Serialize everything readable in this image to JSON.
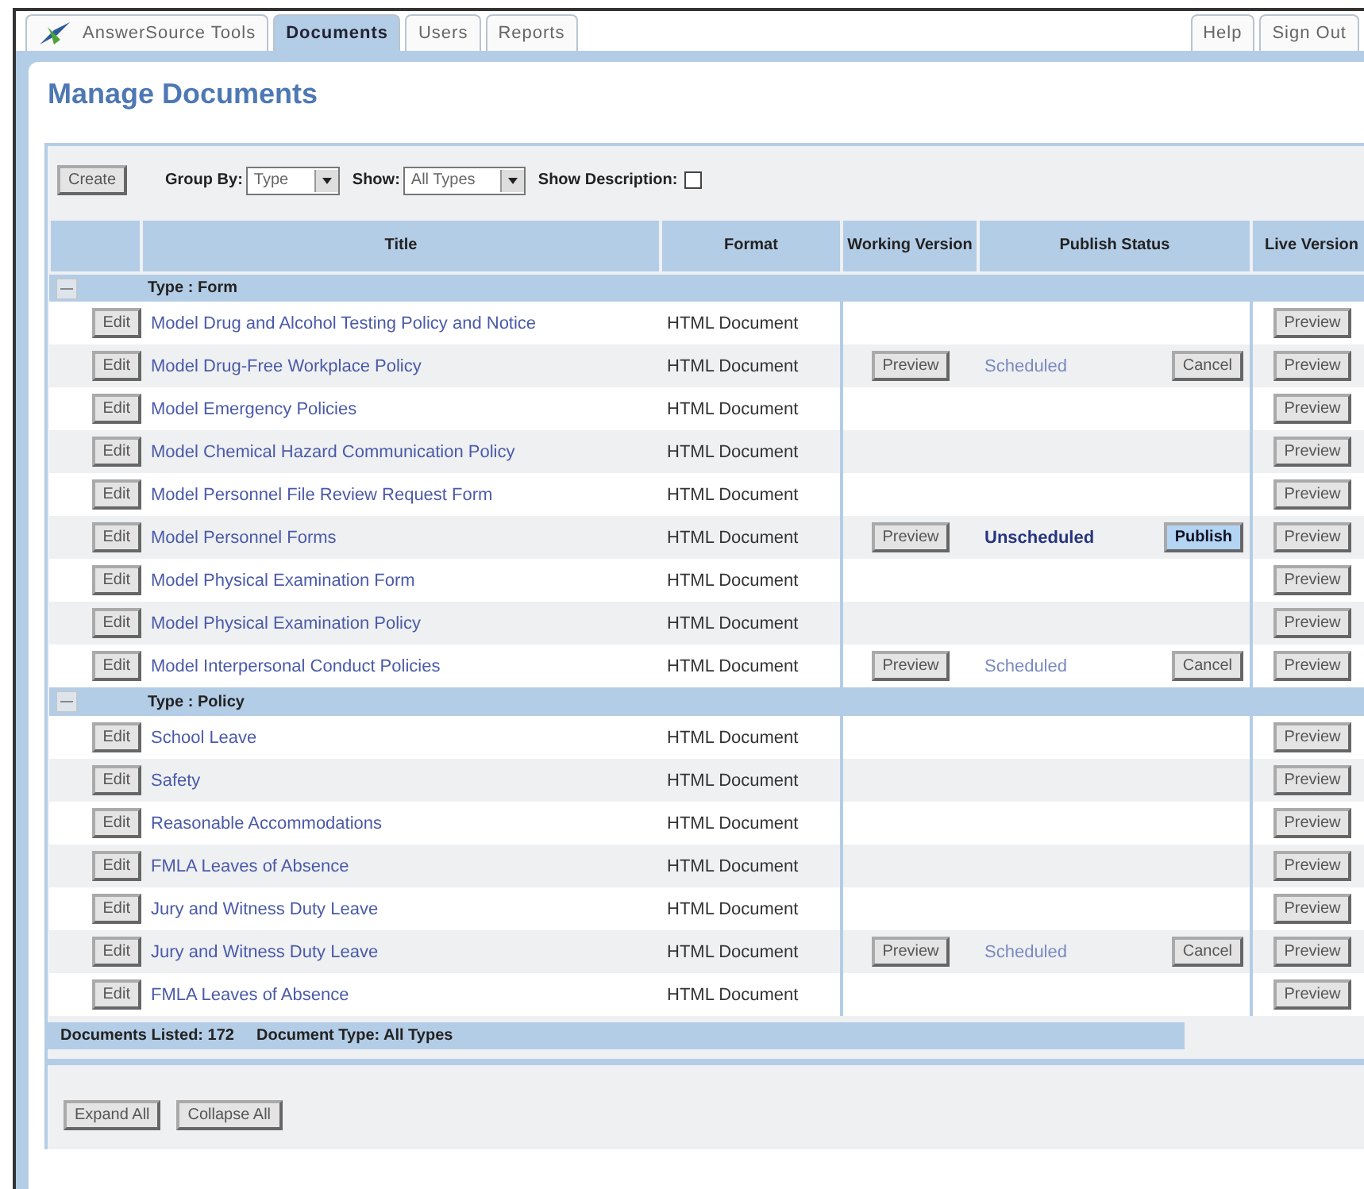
{
  "tabs": [
    {
      "label": "AnswerSource Tools",
      "selected": false,
      "kind": "brand"
    },
    {
      "label": "Documents",
      "selected": true,
      "kind": "main"
    },
    {
      "label": "Users",
      "selected": false,
      "kind": "main"
    },
    {
      "label": "Reports",
      "selected": false,
      "kind": "main"
    },
    {
      "label": "Help",
      "selected": false,
      "kind": "right"
    },
    {
      "label": "Sign Out",
      "selected": false,
      "kind": "right"
    }
  ],
  "heading": "Manage Documents",
  "toolbar": {
    "create": "Create",
    "group_by": {
      "label": "Group By:",
      "value": "Type"
    },
    "show": {
      "label": "Show:",
      "value": "All Types"
    },
    "show_description": {
      "label": "Show Description:",
      "checked": false
    }
  },
  "table": {
    "columns": [
      "Title",
      "Format",
      "Working Version",
      "Publish Status",
      "Live Version"
    ],
    "groups": [
      {
        "label": "Type : Form",
        "expanded": true,
        "rows": [
          {
            "edit": "Edit",
            "title": "Model Drug and Alcohol Testing Policy and Notice",
            "format": "HTML Document",
            "live": "Preview"
          },
          {
            "edit": "Edit",
            "title": "Model Drug-Free Workplace Policy",
            "format": "HTML Document",
            "working": "Preview",
            "status": "Scheduled",
            "scheduled": true,
            "action": "Cancel",
            "live": "Preview"
          },
          {
            "edit": "Edit",
            "title": "Model Emergency Policies",
            "format": "HTML Document",
            "live": "Preview"
          },
          {
            "edit": "Edit",
            "title": "Model Chemical Hazard Communication Policy",
            "format": "HTML Document",
            "live": "Preview"
          },
          {
            "edit": "Edit",
            "title": "Model Personnel File Review Request Form",
            "format": "HTML Document",
            "live": "Preview"
          },
          {
            "edit": "Edit",
            "title": "Model Personnel Forms",
            "format": "HTML Document",
            "working": "Preview",
            "status": "Unscheduled",
            "scheduled": false,
            "action": "Publish",
            "live": "Preview"
          },
          {
            "edit": "Edit",
            "title": "Model Physical Examination Form",
            "format": "HTML Document",
            "live": "Preview"
          },
          {
            "edit": "Edit",
            "title": "Model Physical Examination Policy",
            "format": "HTML Document",
            "live": "Preview"
          },
          {
            "edit": "Edit",
            "title": "Model Interpersonal Conduct Policies",
            "format": "HTML Document",
            "working": "Preview",
            "status": "Scheduled",
            "scheduled": true,
            "action": "Cancel",
            "live": "Preview"
          }
        ]
      },
      {
        "label": "Type : Policy",
        "expanded": true,
        "rows": [
          {
            "edit": "Edit",
            "title": "School Leave",
            "format": "HTML Document",
            "live": "Preview"
          },
          {
            "edit": "Edit",
            "title": "Safety",
            "format": "HTML Document",
            "live": "Preview"
          },
          {
            "edit": "Edit",
            "title": "Reasonable Accommodations",
            "format": "HTML Document",
            "live": "Preview"
          },
          {
            "edit": "Edit",
            "title": "FMLA Leaves of Absence",
            "format": "HTML Document",
            "live": "Preview"
          },
          {
            "edit": "Edit",
            "title": "Jury and Witness Duty Leave",
            "format": "HTML Document",
            "live": "Preview"
          },
          {
            "edit": "Edit",
            "title": "Jury and Witness Duty Leave",
            "format": "HTML Document",
            "working": "Preview",
            "status": "Scheduled",
            "scheduled": true,
            "action": "Cancel",
            "live": "Preview"
          },
          {
            "edit": "Edit",
            "title": "FMLA Leaves of Absence",
            "format": "HTML Document",
            "live": "Preview"
          }
        ]
      }
    ]
  },
  "status_bar": [
    "Documents Listed: 172",
    "Document Type: All Types"
  ],
  "buttons": [
    "Expand All",
    "Collapse All"
  ]
}
